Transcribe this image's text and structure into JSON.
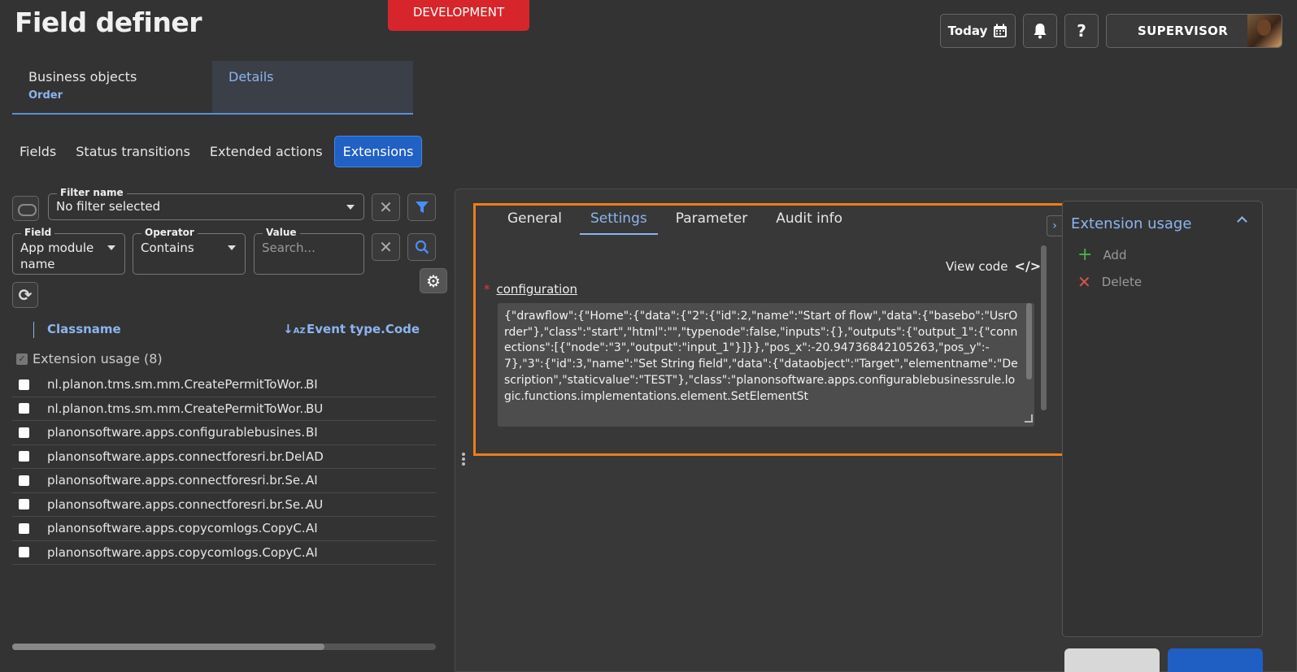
{
  "app": {
    "title": "Field definer",
    "environment": "DEVELOPMENT"
  },
  "header": {
    "today_label": "Today",
    "user_label": "SUPERVISOR"
  },
  "bo_tabs": [
    {
      "label": "Business objects",
      "sub": "Order"
    },
    {
      "label": "Details"
    }
  ],
  "subtabs": [
    "Fields",
    "Status transitions",
    "Extended actions",
    "Extensions"
  ],
  "filter": {
    "name_label": "Filter name",
    "name_value": "No filter selected",
    "field_label": "Field",
    "field_value": "App module name",
    "operator_label": "Operator",
    "operator_value": "Contains",
    "value_label": "Value",
    "value_placeholder": "Search..."
  },
  "list": {
    "col_classname": "Classname",
    "col_event": "Event type.Code",
    "group_label": "Extension usage (8)",
    "rows": [
      {
        "classname": "nl.planon.tms.sm.mm.CreatePermitToWor...",
        "code": "BI"
      },
      {
        "classname": "nl.planon.tms.sm.mm.CreatePermitToWor...",
        "code": "BU"
      },
      {
        "classname": "planonsoftware.apps.configurablebusines...",
        "code": "BI"
      },
      {
        "classname": "planonsoftware.apps.connectforesri.br.Del...",
        "code": "AD"
      },
      {
        "classname": "planonsoftware.apps.connectforesri.br.Se...",
        "code": "AI"
      },
      {
        "classname": "planonsoftware.apps.connectforesri.br.Se...",
        "code": "AU"
      },
      {
        "classname": "planonsoftware.apps.copycomlogs.CopyC...",
        "code": "AI"
      },
      {
        "classname": "planonsoftware.apps.copycomlogs.CopyC...",
        "code": "AI"
      }
    ]
  },
  "detail": {
    "tabs": [
      "General",
      "Settings",
      "Parameter",
      "Audit info"
    ],
    "view_code": "View code",
    "view_code_icon": "</>",
    "required_mark": "*",
    "config_label": "configuration",
    "config_value": "{\"drawflow\":{\"Home\":{\"data\":{\"2\":{\"id\":2,\"name\":\"Start of flow\",\"data\":{\"basebo\":\"UsrOrder\"},\"class\":\"start\",\"html\":\"\",\"typenode\":false,\"inputs\":{},\"outputs\":{\"output_1\":{\"connections\":[{\"node\":\"3\",\"output\":\"input_1\"}]}},\"pos_x\":-20.94736842105263,\"pos_y\":-7},\"3\":{\"id\":3,\"name\":\"Set String field\",\"data\":{\"dataobject\":\"Target\",\"elementname\":\"Description\",\"staticvalue\":\"TEST\"},\"class\":\"planonsoftware.apps.configurablebusinessrule.logic.functions.implementations.element.SetElementSt"
  },
  "side_panel": {
    "title": "Extension usage",
    "add_label": "Add",
    "delete_label": "Delete"
  },
  "colors": {
    "accent": "#8cb4f0",
    "primary": "#2160c4",
    "highlight": "#f07c1c",
    "env_badge": "#d7262b"
  }
}
